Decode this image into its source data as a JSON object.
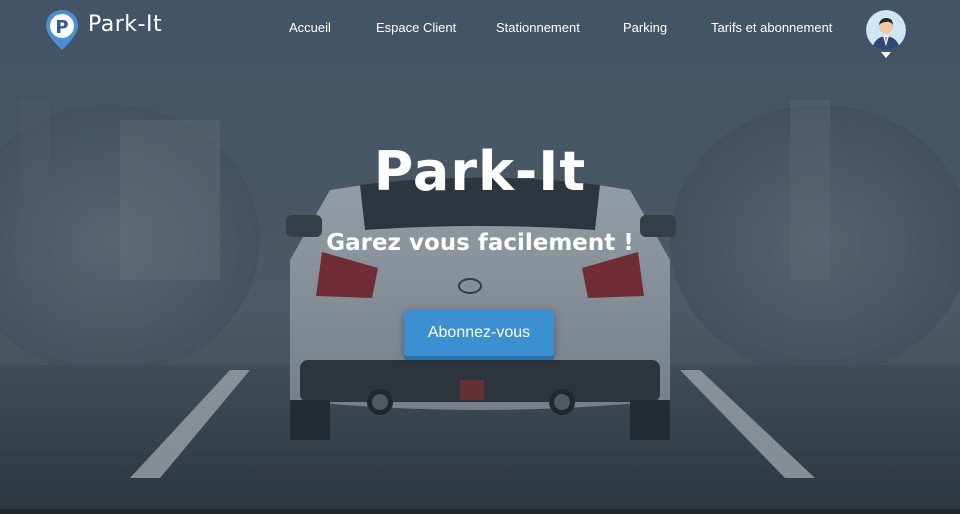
{
  "brand": {
    "name": "Park-It",
    "logo_letter": "P",
    "logo_color": "#4a8fd0"
  },
  "nav": {
    "items": [
      {
        "label": "Accueil"
      },
      {
        "label": "Espace Client"
      },
      {
        "label": "Stationnement"
      },
      {
        "label": "Parking"
      },
      {
        "label": "Tarifs et abonnement"
      }
    ]
  },
  "user_menu": {
    "avatar_icon": "user-avatar-icon",
    "caret_icon": "caret-down-icon"
  },
  "hero": {
    "title": "Park-It",
    "subtitle": "Garez vous facilement !",
    "cta_label": "Abonnez-vous",
    "cta_color": "#3c8fd0"
  }
}
